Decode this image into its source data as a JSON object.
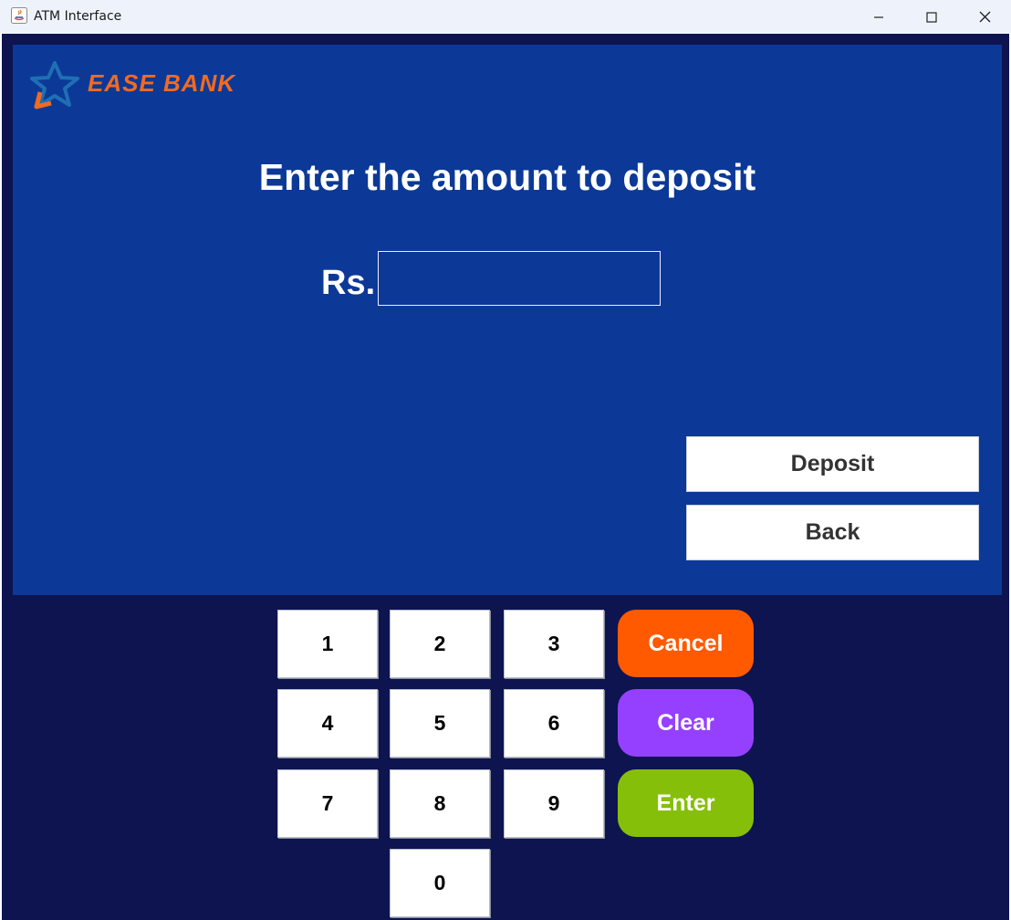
{
  "window": {
    "title": "ATM Interface"
  },
  "bank": {
    "logo_text": "EASE BANK"
  },
  "screen": {
    "prompt": "Enter the amount to deposit",
    "currency_label": "Rs.",
    "amount_value": "",
    "deposit_label": "Deposit",
    "back_label": "Back"
  },
  "keypad": {
    "keys": [
      "1",
      "2",
      "3",
      "4",
      "5",
      "6",
      "7",
      "8",
      "9",
      "0"
    ],
    "cancel_label": "Cancel",
    "clear_label": "Clear",
    "enter_label": "Enter"
  },
  "colors": {
    "screen_bg": "#0c3997",
    "frame_bg": "#0d1450",
    "cancel": "#ff5a00",
    "clear": "#9640ff",
    "enter": "#86bf0a",
    "logo_orange": "#f26a21",
    "logo_blue": "#1a6bb0"
  }
}
